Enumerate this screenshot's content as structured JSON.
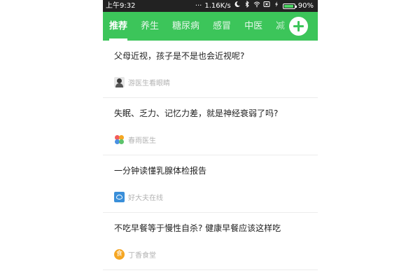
{
  "status_bar": {
    "time": "上午9:32",
    "dots": "···",
    "network_speed": "1.16K/s",
    "battery_percent": "90%",
    "battery_level": 0.9,
    "icons": [
      "moon-icon",
      "bluetooth-icon",
      "wifi-icon",
      "sim-x-icon",
      "charging-icon",
      "battery-icon"
    ]
  },
  "tabs": [
    {
      "label": "推荐",
      "active": true
    },
    {
      "label": "养生",
      "active": false
    },
    {
      "label": "糖尿病",
      "active": false
    },
    {
      "label": "感冒",
      "active": false
    },
    {
      "label": "中医",
      "active": false
    },
    {
      "label": "减",
      "active": false
    }
  ],
  "feed": [
    {
      "title": "父母近视，孩子是不是也会近视呢?",
      "source": "游医生看眼睛",
      "avatar": "photo-avatar"
    },
    {
      "title": "失眠、乏力、记忆力差，就是神经衰弱了吗?",
      "source": "春雨医生",
      "avatar": "clover-logo"
    },
    {
      "title": "一分钟读懂乳腺体检报告",
      "source": "好大夫在线",
      "avatar": "heart-logo"
    },
    {
      "title": "不吃早餐等于慢性自杀? 健康早餐应该这样吃",
      "source": "丁香食堂",
      "avatar": "food-logo",
      "avatar_glyph": "食"
    }
  ],
  "colors": {
    "accent": "#3cc55a",
    "status_bar": "#222222",
    "title_text": "#222222",
    "source_text": "#b3b3b3",
    "divider": "#ececec"
  }
}
